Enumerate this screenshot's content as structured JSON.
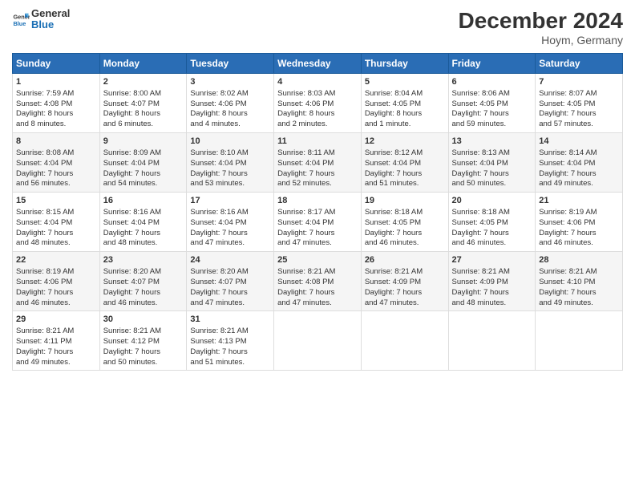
{
  "header": {
    "logo_line1": "General",
    "logo_line2": "Blue",
    "title": "December 2024",
    "subtitle": "Hoym, Germany"
  },
  "days_of_week": [
    "Sunday",
    "Monday",
    "Tuesday",
    "Wednesday",
    "Thursday",
    "Friday",
    "Saturday"
  ],
  "weeks": [
    [
      {
        "day": "1",
        "lines": [
          "Sunrise: 7:59 AM",
          "Sunset: 4:08 PM",
          "Daylight: 8 hours",
          "and 8 minutes."
        ]
      },
      {
        "day": "2",
        "lines": [
          "Sunrise: 8:00 AM",
          "Sunset: 4:07 PM",
          "Daylight: 8 hours",
          "and 6 minutes."
        ]
      },
      {
        "day": "3",
        "lines": [
          "Sunrise: 8:02 AM",
          "Sunset: 4:06 PM",
          "Daylight: 8 hours",
          "and 4 minutes."
        ]
      },
      {
        "day": "4",
        "lines": [
          "Sunrise: 8:03 AM",
          "Sunset: 4:06 PM",
          "Daylight: 8 hours",
          "and 2 minutes."
        ]
      },
      {
        "day": "5",
        "lines": [
          "Sunrise: 8:04 AM",
          "Sunset: 4:05 PM",
          "Daylight: 8 hours",
          "and 1 minute."
        ]
      },
      {
        "day": "6",
        "lines": [
          "Sunrise: 8:06 AM",
          "Sunset: 4:05 PM",
          "Daylight: 7 hours",
          "and 59 minutes."
        ]
      },
      {
        "day": "7",
        "lines": [
          "Sunrise: 8:07 AM",
          "Sunset: 4:05 PM",
          "Daylight: 7 hours",
          "and 57 minutes."
        ]
      }
    ],
    [
      {
        "day": "8",
        "lines": [
          "Sunrise: 8:08 AM",
          "Sunset: 4:04 PM",
          "Daylight: 7 hours",
          "and 56 minutes."
        ]
      },
      {
        "day": "9",
        "lines": [
          "Sunrise: 8:09 AM",
          "Sunset: 4:04 PM",
          "Daylight: 7 hours",
          "and 54 minutes."
        ]
      },
      {
        "day": "10",
        "lines": [
          "Sunrise: 8:10 AM",
          "Sunset: 4:04 PM",
          "Daylight: 7 hours",
          "and 53 minutes."
        ]
      },
      {
        "day": "11",
        "lines": [
          "Sunrise: 8:11 AM",
          "Sunset: 4:04 PM",
          "Daylight: 7 hours",
          "and 52 minutes."
        ]
      },
      {
        "day": "12",
        "lines": [
          "Sunrise: 8:12 AM",
          "Sunset: 4:04 PM",
          "Daylight: 7 hours",
          "and 51 minutes."
        ]
      },
      {
        "day": "13",
        "lines": [
          "Sunrise: 8:13 AM",
          "Sunset: 4:04 PM",
          "Daylight: 7 hours",
          "and 50 minutes."
        ]
      },
      {
        "day": "14",
        "lines": [
          "Sunrise: 8:14 AM",
          "Sunset: 4:04 PM",
          "Daylight: 7 hours",
          "and 49 minutes."
        ]
      }
    ],
    [
      {
        "day": "15",
        "lines": [
          "Sunrise: 8:15 AM",
          "Sunset: 4:04 PM",
          "Daylight: 7 hours",
          "and 48 minutes."
        ]
      },
      {
        "day": "16",
        "lines": [
          "Sunrise: 8:16 AM",
          "Sunset: 4:04 PM",
          "Daylight: 7 hours",
          "and 48 minutes."
        ]
      },
      {
        "day": "17",
        "lines": [
          "Sunrise: 8:16 AM",
          "Sunset: 4:04 PM",
          "Daylight: 7 hours",
          "and 47 minutes."
        ]
      },
      {
        "day": "18",
        "lines": [
          "Sunrise: 8:17 AM",
          "Sunset: 4:04 PM",
          "Daylight: 7 hours",
          "and 47 minutes."
        ]
      },
      {
        "day": "19",
        "lines": [
          "Sunrise: 8:18 AM",
          "Sunset: 4:05 PM",
          "Daylight: 7 hours",
          "and 46 minutes."
        ]
      },
      {
        "day": "20",
        "lines": [
          "Sunrise: 8:18 AM",
          "Sunset: 4:05 PM",
          "Daylight: 7 hours",
          "and 46 minutes."
        ]
      },
      {
        "day": "21",
        "lines": [
          "Sunrise: 8:19 AM",
          "Sunset: 4:06 PM",
          "Daylight: 7 hours",
          "and 46 minutes."
        ]
      }
    ],
    [
      {
        "day": "22",
        "lines": [
          "Sunrise: 8:19 AM",
          "Sunset: 4:06 PM",
          "Daylight: 7 hours",
          "and 46 minutes."
        ]
      },
      {
        "day": "23",
        "lines": [
          "Sunrise: 8:20 AM",
          "Sunset: 4:07 PM",
          "Daylight: 7 hours",
          "and 46 minutes."
        ]
      },
      {
        "day": "24",
        "lines": [
          "Sunrise: 8:20 AM",
          "Sunset: 4:07 PM",
          "Daylight: 7 hours",
          "and 47 minutes."
        ]
      },
      {
        "day": "25",
        "lines": [
          "Sunrise: 8:21 AM",
          "Sunset: 4:08 PM",
          "Daylight: 7 hours",
          "and 47 minutes."
        ]
      },
      {
        "day": "26",
        "lines": [
          "Sunrise: 8:21 AM",
          "Sunset: 4:09 PM",
          "Daylight: 7 hours",
          "and 47 minutes."
        ]
      },
      {
        "day": "27",
        "lines": [
          "Sunrise: 8:21 AM",
          "Sunset: 4:09 PM",
          "Daylight: 7 hours",
          "and 48 minutes."
        ]
      },
      {
        "day": "28",
        "lines": [
          "Sunrise: 8:21 AM",
          "Sunset: 4:10 PM",
          "Daylight: 7 hours",
          "and 49 minutes."
        ]
      }
    ],
    [
      {
        "day": "29",
        "lines": [
          "Sunrise: 8:21 AM",
          "Sunset: 4:11 PM",
          "Daylight: 7 hours",
          "and 49 minutes."
        ]
      },
      {
        "day": "30",
        "lines": [
          "Sunrise: 8:21 AM",
          "Sunset: 4:12 PM",
          "Daylight: 7 hours",
          "and 50 minutes."
        ]
      },
      {
        "day": "31",
        "lines": [
          "Sunrise: 8:21 AM",
          "Sunset: 4:13 PM",
          "Daylight: 7 hours",
          "and 51 minutes."
        ]
      },
      {
        "day": "",
        "lines": []
      },
      {
        "day": "",
        "lines": []
      },
      {
        "day": "",
        "lines": []
      },
      {
        "day": "",
        "lines": []
      }
    ]
  ]
}
